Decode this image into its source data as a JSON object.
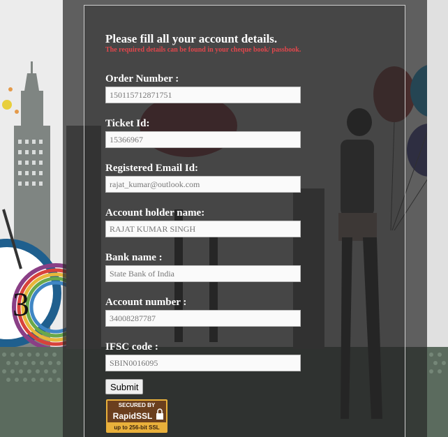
{
  "form": {
    "title": "Please fill all your account details.",
    "subtitle": "The required details can be found in your cheque book/ passbook.",
    "fields": [
      {
        "label": "Order Number :",
        "value": "150115712871751"
      },
      {
        "label": "Ticket Id:",
        "value": "15366967"
      },
      {
        "label": "Registered Email Id:",
        "value": "rajat_kumar@outlook.com"
      },
      {
        "label": "Account holder name:",
        "value": "RAJAT KUMAR SINGH"
      },
      {
        "label": "Bank name :",
        "value": "State Bank of India"
      },
      {
        "label": "Account number :",
        "value": "34008287787"
      },
      {
        "label": "IFSC code :",
        "value": "SBIN0016095"
      }
    ],
    "submit_label": "Submit"
  },
  "ssl_badge": {
    "line1": "SECURED BY",
    "brand": "RapidSSL",
    "line3": "up to 256-bit SSL"
  },
  "background": {
    "clock_number": "3"
  }
}
